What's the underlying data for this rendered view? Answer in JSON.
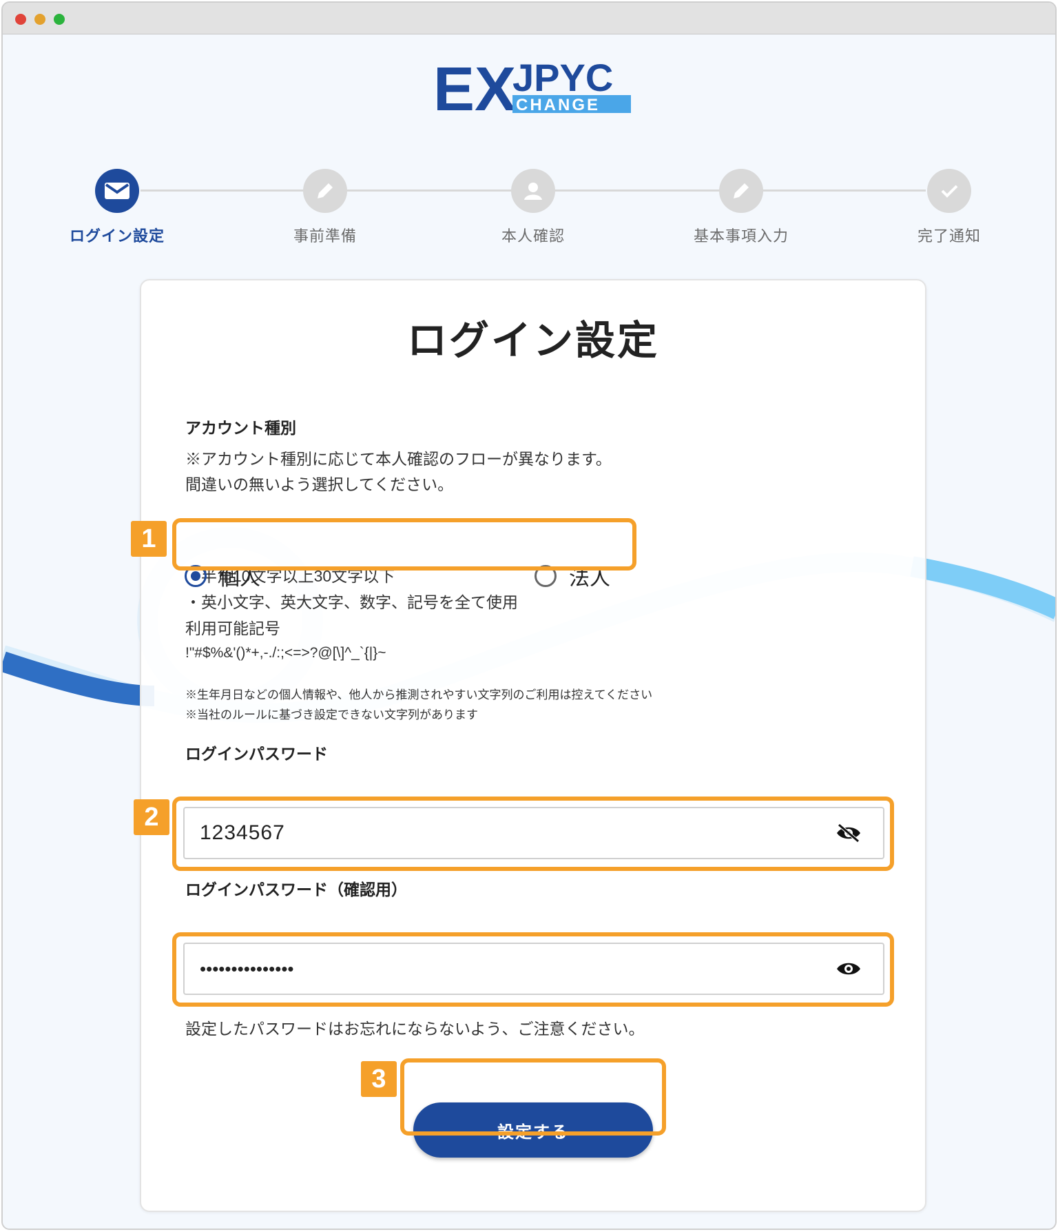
{
  "logo": {
    "text_main": "EX",
    "text_jpyc": "JPYC",
    "text_change": "CHANGE"
  },
  "stepper": {
    "steps": [
      {
        "label": "ログイン設定",
        "icon": "mail-icon",
        "active": true
      },
      {
        "label": "事前準備",
        "icon": "pencil-icon",
        "active": false
      },
      {
        "label": "本人確認",
        "icon": "person-icon",
        "active": false
      },
      {
        "label": "基本事項入力",
        "icon": "pencil-icon",
        "active": false
      },
      {
        "label": "完了通知",
        "icon": "check-icon",
        "active": false
      }
    ]
  },
  "form": {
    "title": "ログイン設定",
    "account_type": {
      "label": "アカウント種別",
      "note_line1": "※アカウント種別に応じて本人確認のフローが異なります。",
      "note_line2": "間違いの無いよう選択してください。",
      "options": [
        {
          "label": "個人",
          "checked": true
        },
        {
          "label": "法人",
          "checked": false
        }
      ]
    },
    "rules": {
      "line1": "・半角10文字以上30文字以下",
      "line2": "・英小文字、英大文字、数字、記号を全て使用",
      "line3": "利用可能記号",
      "symbols": "!\"#$%&'()*+,-./:;<=>?@[\\]^_`{|}~",
      "caution1": "※生年月日などの個人情報や、他人から推測されやすい文字列のご利用は控えてください",
      "caution2": "※当社のルールに基づき設定できない文字列があります"
    },
    "password": {
      "label": "ログインパスワード",
      "value": "1234567"
    },
    "password_confirm": {
      "label": "ログインパスワード（確認用）",
      "value": "•••••••••••••••"
    },
    "footer_note": "設定したパスワードはお忘れにならないよう、ご注意ください。",
    "submit_label": "設定する"
  },
  "badges": [
    "1",
    "2",
    "3"
  ],
  "colors": {
    "brand_blue": "#1e4a9c",
    "highlight_orange": "#f5a02a",
    "wave_light": "#7ecdf7"
  }
}
